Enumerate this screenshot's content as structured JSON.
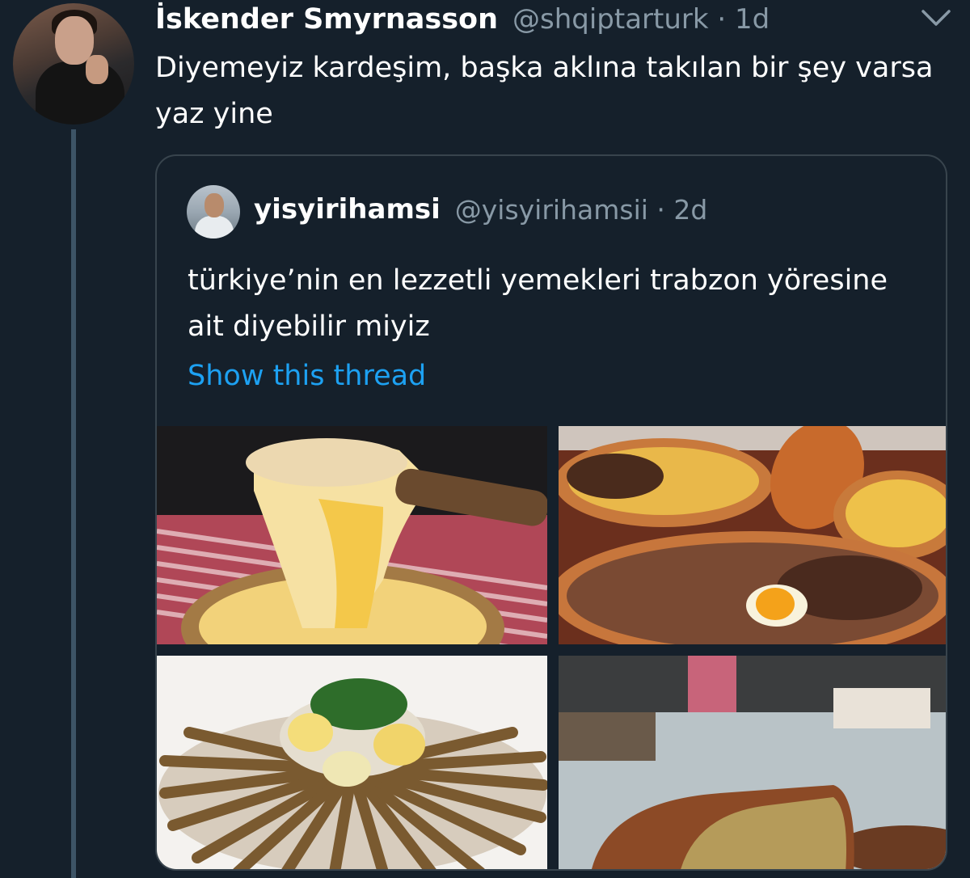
{
  "tweet": {
    "author_name": "İskender Smyrnasson",
    "meta": "@shqiptarturk · 1d",
    "text": "Diyemeyiz kardeşim, başka aklına takılan bir şey varsa yaz yine"
  },
  "quoted": {
    "author_name": "yisyirihamsi",
    "meta": "@yisyirihamsii · 2d",
    "text": "türkiye’nin en lezzetli yemekleri trabzon yöresine ait diyebilir miyiz",
    "link_label": "Show this thread"
  },
  "colors": {
    "background": "#15202b",
    "link": "#1da1f2",
    "muted": "#8899a6",
    "border": "#38444d"
  },
  "icons": [
    "chevron-down-icon"
  ]
}
